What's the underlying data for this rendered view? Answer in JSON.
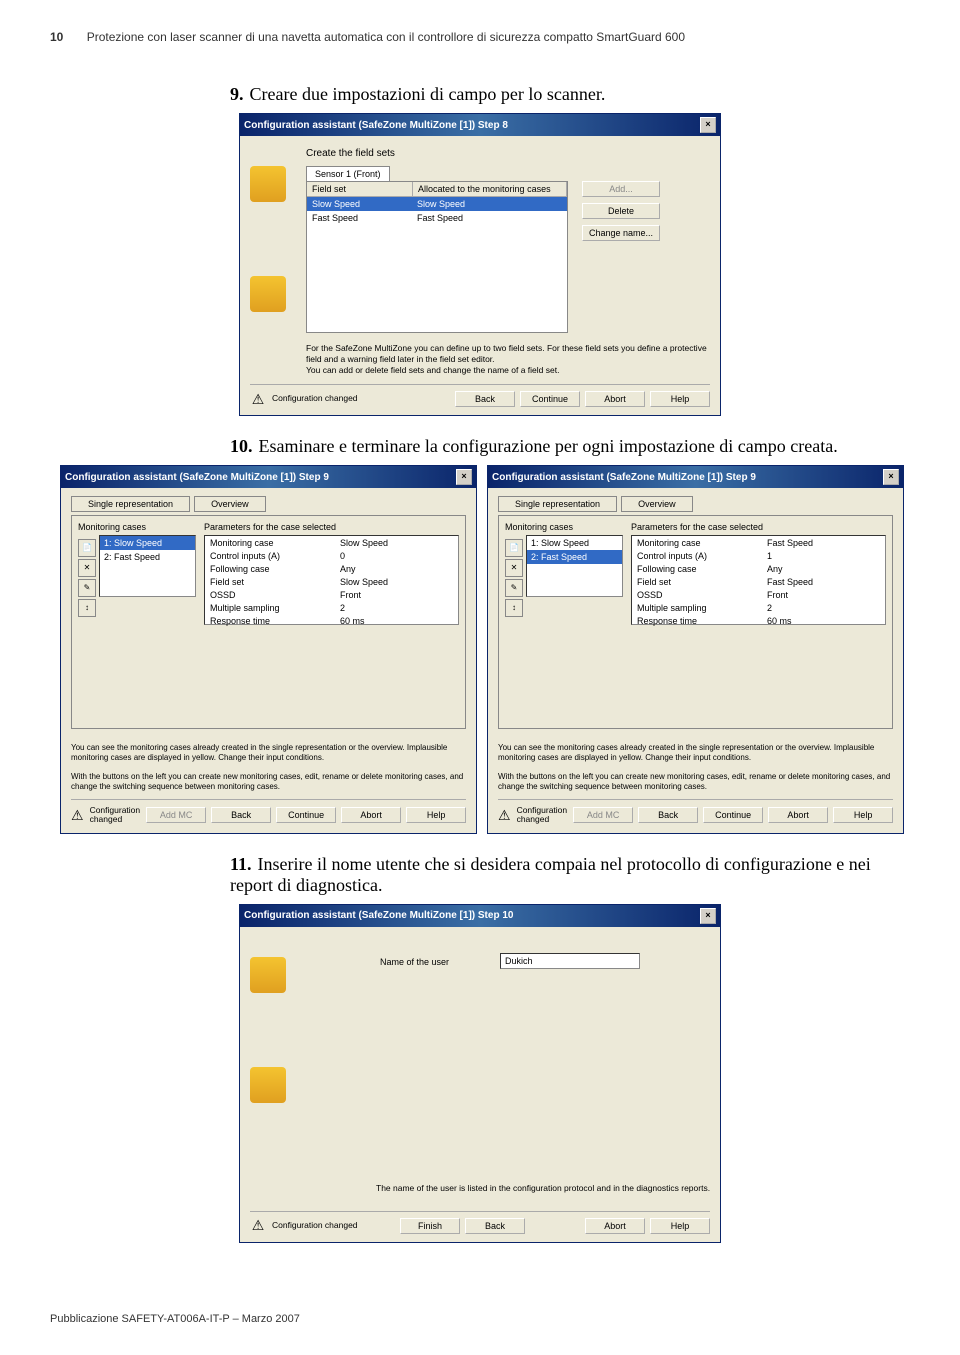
{
  "header": {
    "page_number": "10",
    "title": "Protezione con laser scanner di una navetta automatica con il controllore di sicurezza compatto SmartGuard 600"
  },
  "steps": {
    "s9": {
      "num": "9.",
      "text": "Creare due impostazioni di campo per lo scanner."
    },
    "s10": {
      "num": "10.",
      "text": "Esaminare e terminare la configurazione per ogni impostazione di campo creata."
    },
    "s11": {
      "num": "11.",
      "text": "Inserire il nome utente che si desidera compaia nel protocollo di configurazione e nei report di diagnostica."
    }
  },
  "dialog8": {
    "title": "Configuration assistant (SafeZone MultiZone [1]) Step 8",
    "heading": "Create the field sets",
    "tab": "Sensor 1 (Front)",
    "col1": "Field set",
    "col2": "Allocated to the monitoring cases",
    "rows": [
      {
        "name": "Slow Speed",
        "alloc": "Slow Speed",
        "selected": true
      },
      {
        "name": "Fast Speed",
        "alloc": "Fast Speed",
        "selected": false
      }
    ],
    "btn_add": "Add...",
    "btn_del": "Delete",
    "btn_rename": "Change name...",
    "note": "For the SafeZone MultiZone you can define up to two field sets. For these field sets you define a protective field and a warning field later in the field set editor.\nYou can add or delete field sets and change the name of a field set.",
    "cfg_changed": "Configuration changed",
    "btn_back": "Back",
    "btn_continue": "Continue",
    "btn_abort": "Abort",
    "btn_help": "Help"
  },
  "dialog9a": {
    "title": "Configuration assistant (SafeZone MultiZone [1]) Step 9",
    "tab1": "Single representation",
    "tab2": "Overview",
    "mc_label": "Monitoring cases",
    "mc_items": [
      {
        "text": "1: Slow Speed",
        "selected": true
      },
      {
        "text": "2: Fast Speed",
        "selected": false
      }
    ],
    "param_label": "Parameters for the case selected",
    "params": [
      {
        "k": "Monitoring case",
        "v": "Slow Speed"
      },
      {
        "k": "Control inputs (A)",
        "v": "0"
      },
      {
        "k": "Following case",
        "v": "Any"
      },
      {
        "k": "Field set",
        "v": "Slow Speed"
      },
      {
        "k": "OSSD",
        "v": "Front"
      },
      {
        "k": "Multiple sampling",
        "v": "2"
      },
      {
        "k": "Response time",
        "v": "60 ms"
      }
    ],
    "note": "You can see the monitoring cases already created in the single representation or the overview. Implausible monitoring cases are displayed in yellow. Change their input conditions.\n\nWith the buttons on the left you can create new monitoring cases, edit, rename or delete monitoring cases, and change the switching sequence between monitoring cases.",
    "cfg_changed": "Configuration changed",
    "btn_addmc": "Add MC",
    "btn_back": "Back",
    "btn_continue": "Continue",
    "btn_abort": "Abort",
    "btn_help": "Help"
  },
  "dialog9b": {
    "title": "Configuration assistant (SafeZone MultiZone [1]) Step 9",
    "tab1": "Single representation",
    "tab2": "Overview",
    "mc_label": "Monitoring cases",
    "mc_items": [
      {
        "text": "1: Slow Speed",
        "selected": false
      },
      {
        "text": "2: Fast Speed",
        "selected": true
      }
    ],
    "param_label": "Parameters for the case selected",
    "params": [
      {
        "k": "Monitoring case",
        "v": "Fast Speed"
      },
      {
        "k": "Control inputs (A)",
        "v": "1"
      },
      {
        "k": "Following case",
        "v": "Any"
      },
      {
        "k": "Field set",
        "v": "Fast Speed"
      },
      {
        "k": "OSSD",
        "v": "Front"
      },
      {
        "k": "Multiple sampling",
        "v": "2"
      },
      {
        "k": "Response time",
        "v": "60 ms"
      }
    ],
    "note": "You can see the monitoring cases already created in the single representation or the overview. Implausible monitoring cases are displayed in yellow. Change their input conditions.\n\nWith the buttons on the left you can create new monitoring cases, edit, rename or delete monitoring cases, and change the switching sequence between monitoring cases.",
    "cfg_changed": "Configuration changed",
    "btn_addmc": "Add MC",
    "btn_back": "Back",
    "btn_continue": "Continue",
    "btn_abort": "Abort",
    "btn_help": "Help"
  },
  "dialog10": {
    "title": "Configuration assistant (SafeZone MultiZone [1]) Step 10",
    "name_label": "Name of the user",
    "name_value": "Dukich",
    "note": "The name of the user is listed in the configuration protocol and in the diagnostics reports.",
    "cfg_changed": "Configuration changed",
    "btn_finish": "Finish",
    "btn_back": "Back",
    "btn_abort": "Abort",
    "btn_help": "Help"
  },
  "footer": {
    "text": "Pubblicazione SAFETY-AT006A-IT-P – Marzo 2007"
  }
}
